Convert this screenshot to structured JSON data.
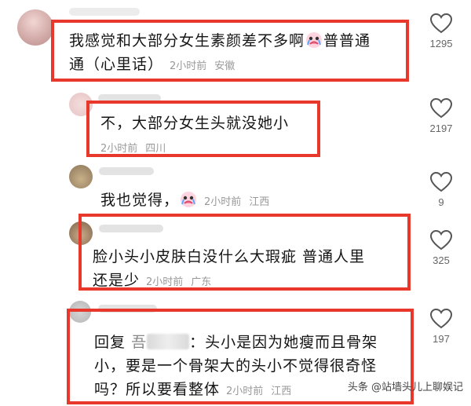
{
  "comments": [
    {
      "text_line1": "我感觉和大部分女生素颜差不多啊",
      "text_after_emoji": "普普通",
      "text_line2": "通（心里话）",
      "time": "2小时前",
      "location": "安徽",
      "likes": "1295"
    },
    {
      "text": "不，大部分女生头就没她小",
      "time": "2小时前",
      "location": "四川",
      "likes": "2197"
    },
    {
      "text": "我也觉得，",
      "time": "2小时前",
      "location": "江西",
      "likes": "9"
    },
    {
      "text_line1": "脸小头小皮肤白没什么大瑕疵 普通人里",
      "text_line2": "还是少",
      "time": "2小时前",
      "location": "广东",
      "likes": "325"
    },
    {
      "reply_prefix": "回复",
      "reply_name_visible": "吾",
      "text_after_name": "：头小是因为她瘦而且骨架",
      "text_line2": "小，要是一个骨架大的头小不觉得很奇怪",
      "text_line3": "吗？所以要看整体",
      "time": "2小时前",
      "location": "江西",
      "likes": "197"
    }
  ],
  "watermark": "头条 @站墙头儿上聊娱记",
  "colors": {
    "highlight_box": "#e8372b",
    "meta_gray": "#999999"
  },
  "icons": {
    "like": "heart-outline-icon",
    "emoji": "crying-face-emoji-icon"
  }
}
